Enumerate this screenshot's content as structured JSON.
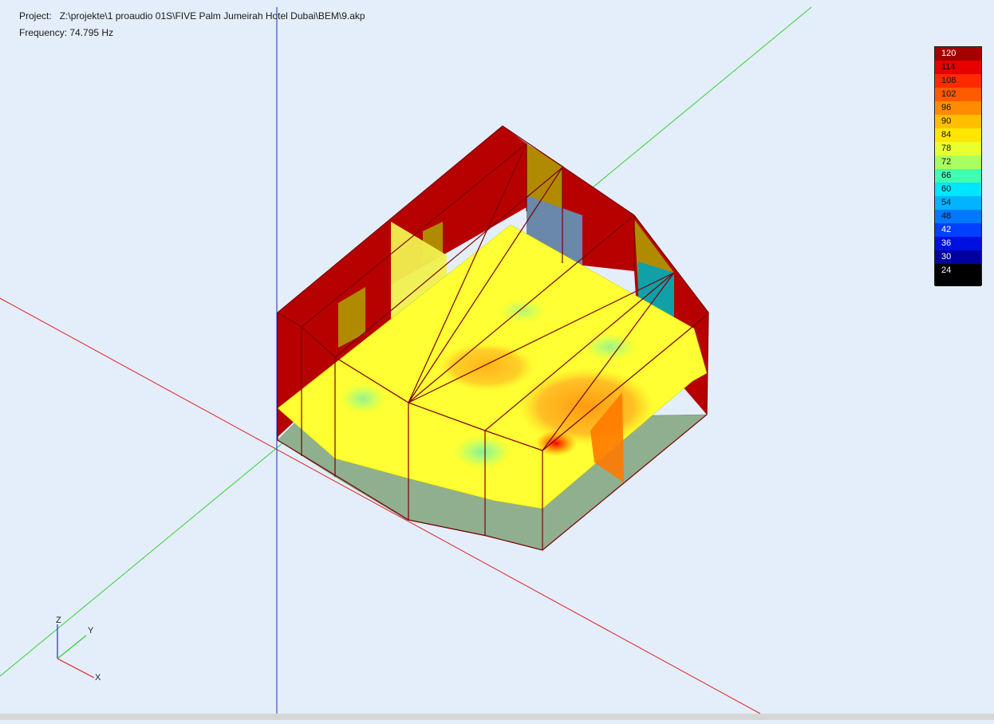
{
  "header": {
    "project_label": "Project:",
    "project_path": "Z:\\projekte\\1 proaudio 01S\\FIVE Palm Jumeirah Hotel Dubai\\BEM\\9.akp",
    "frequency_label": "Frequency:",
    "frequency_value": "74.795 Hz"
  },
  "legend": {
    "levels": [
      "120",
      "114",
      "108",
      "102",
      "96",
      "90",
      "84",
      "78",
      "72",
      "66",
      "60",
      "54",
      "48",
      "42",
      "36",
      "30",
      "24"
    ],
    "colors": [
      "#a50000",
      "#e60000",
      "#ff2a00",
      "#ff5a00",
      "#ff8c00",
      "#ffbe00",
      "#ffe600",
      "#e8ff30",
      "#a8ff60",
      "#40ffb0",
      "#00e6ff",
      "#00b4ff",
      "#0078ff",
      "#0040ff",
      "#0010e0",
      "#0000a0",
      "#000000"
    ]
  },
  "axes_gizmo": {
    "z": "Z",
    "y": "Y",
    "x": "X"
  },
  "colors": {
    "background": "#e4eefa",
    "wall_red": "#b70000",
    "floor_grey": "#8faf8f",
    "field_yellow": "#ffff33",
    "axis_red": "#e02020",
    "axis_green": "#30d030",
    "axis_blue": "#1a2fbf"
  }
}
